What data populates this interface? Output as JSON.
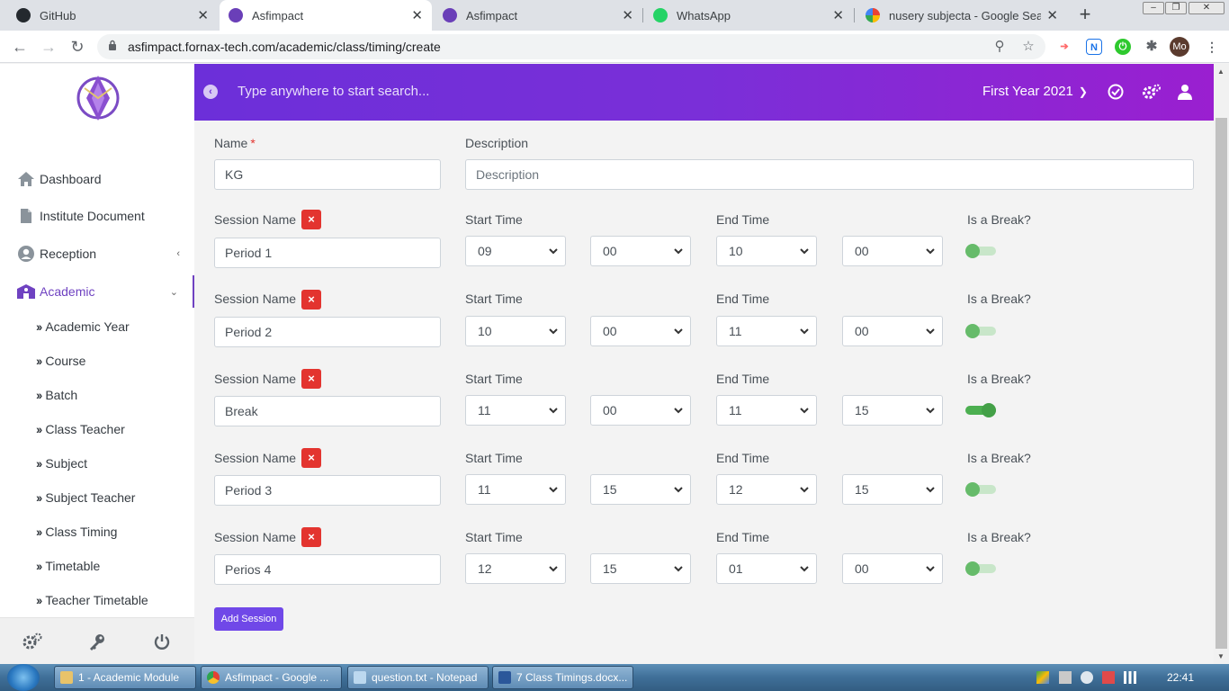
{
  "browser": {
    "tabs": [
      {
        "title": "GitHub",
        "active": false,
        "icon": "github-icon"
      },
      {
        "title": "Asfimpact",
        "active": true,
        "icon": "asfimpact-icon"
      },
      {
        "title": "Asfimpact",
        "active": false,
        "icon": "asfimpact-icon"
      },
      {
        "title": "WhatsApp",
        "active": false,
        "icon": "whatsapp-icon"
      },
      {
        "title": "nusery subjecta - Google Search",
        "active": false,
        "icon": "google-icon"
      }
    ],
    "url": "asfimpact.fornax-tech.com/academic/class/timing/create",
    "profile_initials": "Mo"
  },
  "sidebar": {
    "nav": [
      {
        "label": "Dashboard",
        "icon": "home-icon"
      },
      {
        "label": "Institute Document",
        "icon": "document-icon"
      },
      {
        "label": "Reception",
        "icon": "user-circle-icon",
        "chevron": "‹"
      },
      {
        "label": "Academic",
        "icon": "school-icon",
        "chevron": "⌄"
      }
    ],
    "academic_items": [
      "Academic Year",
      "Course",
      "Batch",
      "Class Teacher",
      "Subject",
      "Subject Teacher",
      "Class Timing",
      "Timetable",
      "Teacher Timetable"
    ]
  },
  "header": {
    "search_placeholder": "Type anywhere to start search...",
    "academic_year": "First Year 2021"
  },
  "form": {
    "name_label": "Name",
    "required_mark": "*",
    "name_value": "KG",
    "description_label": "Description",
    "description_placeholder": "Description",
    "session_name_label": "Session Name",
    "start_time_label": "Start Time",
    "end_time_label": "End Time",
    "break_label": "Is a Break?",
    "remove_glyph": "×",
    "sessions": [
      {
        "name": "Period 1",
        "start_hour": "09",
        "start_minute": "00",
        "end_hour": "10",
        "end_minute": "00",
        "is_break": false
      },
      {
        "name": "Period 2",
        "start_hour": "10",
        "start_minute": "00",
        "end_hour": "11",
        "end_minute": "00",
        "is_break": false
      },
      {
        "name": "Break",
        "start_hour": "11",
        "start_minute": "00",
        "end_hour": "11",
        "end_minute": "15",
        "is_break": true
      },
      {
        "name": "Period 3",
        "start_hour": "11",
        "start_minute": "15",
        "end_hour": "12",
        "end_minute": "15",
        "is_break": false
      },
      {
        "name": "Perios 4",
        "start_hour": "12",
        "start_minute": "15",
        "end_hour": "01",
        "end_minute": "00",
        "is_break": false
      }
    ],
    "add_session_label": "Add Session"
  },
  "taskbar": {
    "tasks": [
      {
        "label": "1 - Academic Module",
        "icon": "folder-icon",
        "color": "#e8c36a"
      },
      {
        "label": "Asfimpact - Google ...",
        "icon": "chrome-icon",
        "color": "#e34133"
      },
      {
        "label": "question.txt - Notepad",
        "icon": "notepad-icon",
        "color": "#bcd8ef"
      },
      {
        "label": "7 Class Timings.docx...",
        "icon": "word-icon",
        "color": "#2b579a"
      }
    ],
    "clock": "22:41"
  },
  "colors": {
    "accent": "#6f42c1",
    "header_start": "#6c2fd9",
    "header_end": "#9a1fd0",
    "danger": "#e3342f",
    "button": "#7048e8",
    "toggle": "#66bb6a"
  }
}
